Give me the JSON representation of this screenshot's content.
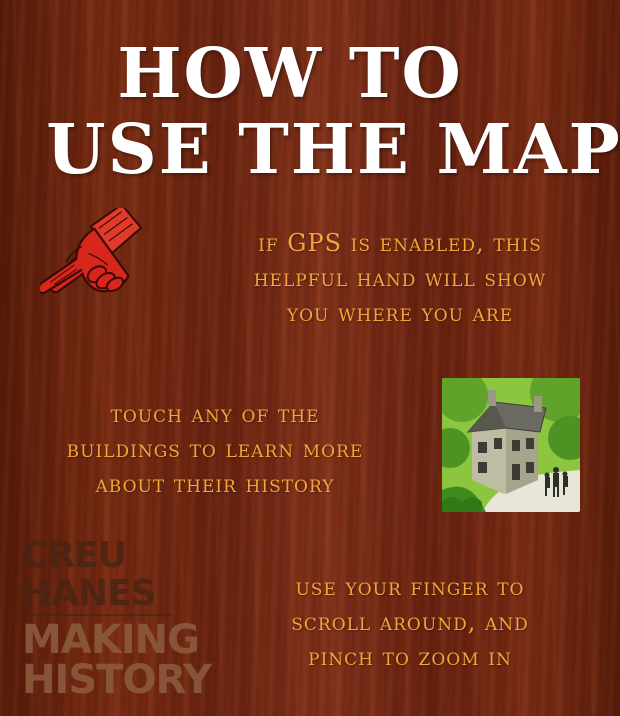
{
  "title": {
    "line1": "HOW TO",
    "line2": "USE THE MAP"
  },
  "instructions": {
    "gps": {
      "lines": [
        "if GPS is enabled, this",
        "helpful hand will show",
        "you where you are"
      ]
    },
    "touch": {
      "lines": [
        "touch any of the",
        "buildings to learn more",
        "about their history"
      ]
    },
    "scroll": {
      "lines": [
        "use your finger to",
        "scroll around, and",
        "pinch to zoom in"
      ]
    }
  },
  "logo": {
    "line1": "CREU",
    "line2": "HANES",
    "line3": "MAKING",
    "line4": "HISTORY"
  },
  "colors": {
    "title": "#ffffff",
    "instruction_text": "#f3a43a",
    "wood": "#6a2410",
    "hand": "#d8261c"
  },
  "icons": {
    "hand": "pointing-hand-icon",
    "building": "building-icon"
  }
}
